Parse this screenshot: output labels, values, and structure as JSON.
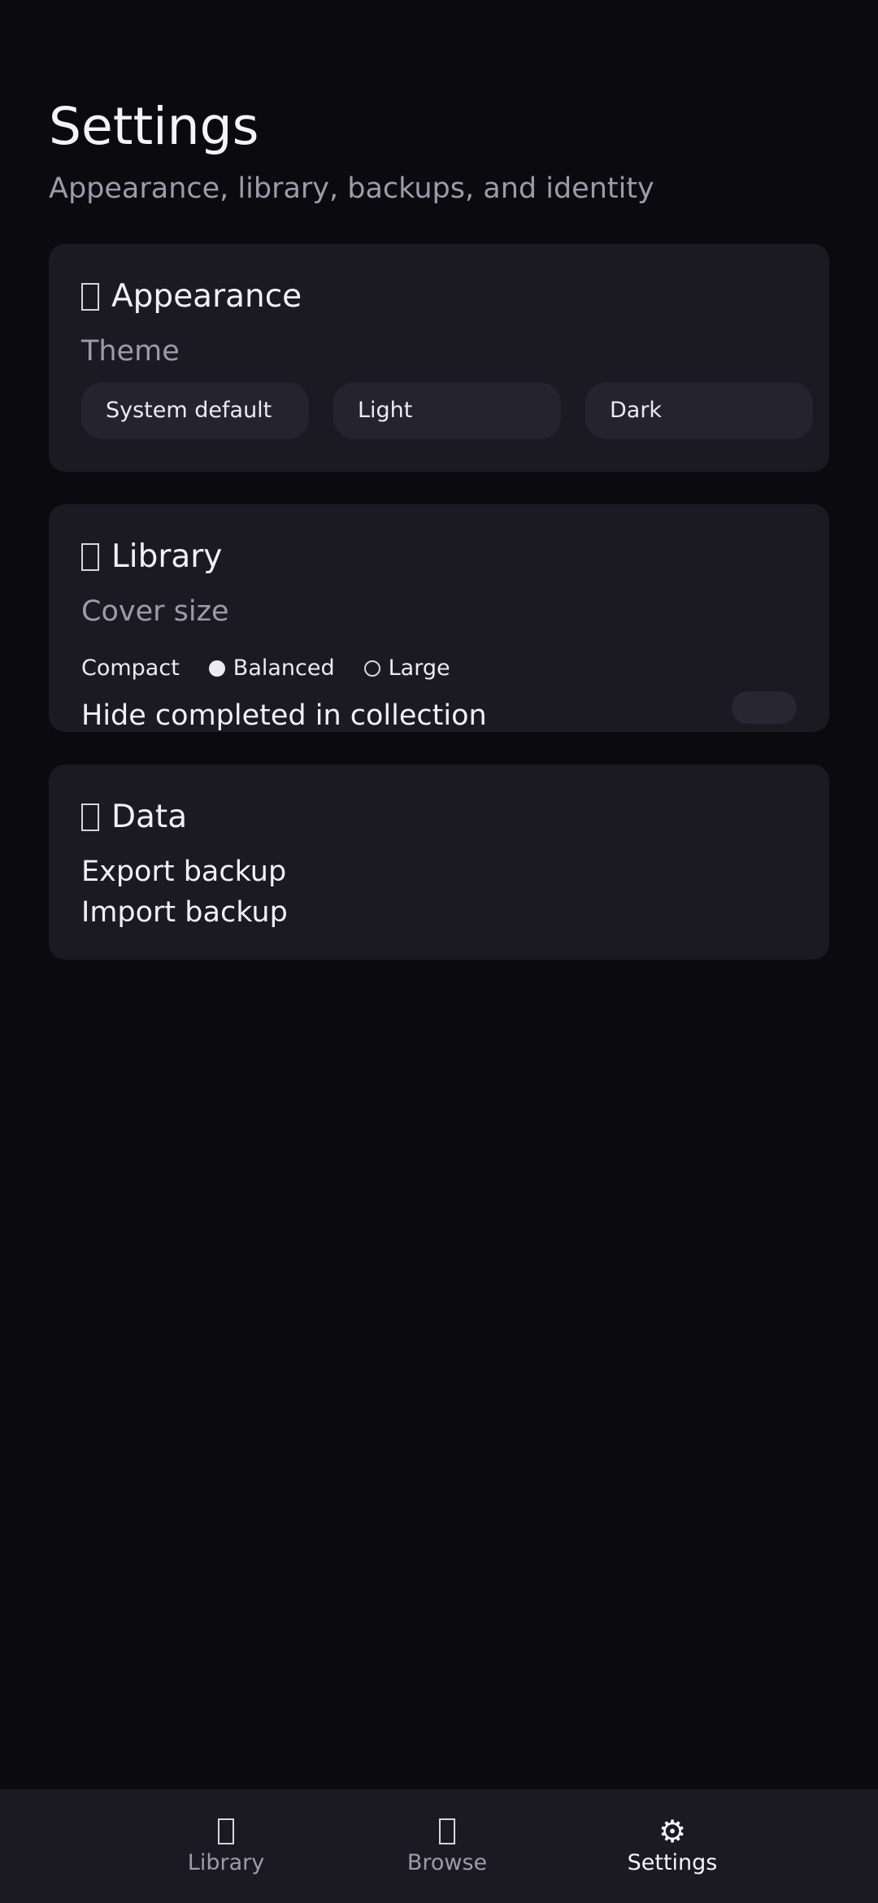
{
  "header": {
    "title": "Settings",
    "subtitle": "Appearance, library, backups, and identity"
  },
  "appearance": {
    "title": "Appearance",
    "icon": "palette-icon",
    "theme_label": "Theme",
    "theme_options": [
      "System default",
      "Light",
      "Dark"
    ]
  },
  "library": {
    "title": "Library",
    "icon": "books-icon",
    "cover_size_label": "Cover size",
    "cover_options": [
      "Compact",
      "Balanced",
      "Large"
    ],
    "cover_selected": "Balanced",
    "hide_completed_label": "Hide completed in collection",
    "hide_completed_on": false
  },
  "data_section": {
    "title": "Data",
    "icon": "database-icon",
    "export_label": "Export backup",
    "import_label": "Import backup"
  },
  "bottom_nav": {
    "items": [
      {
        "label": "Library",
        "icon": "books-icon"
      },
      {
        "label": "Browse",
        "icon": "search-icon"
      },
      {
        "label": "Settings",
        "icon": "⚙"
      }
    ],
    "active": "Settings"
  },
  "colors": {
    "background": "#0b0a0f",
    "card": "#1b1a23",
    "pill": "#25242e",
    "muted_text": "#9d9ba8"
  }
}
